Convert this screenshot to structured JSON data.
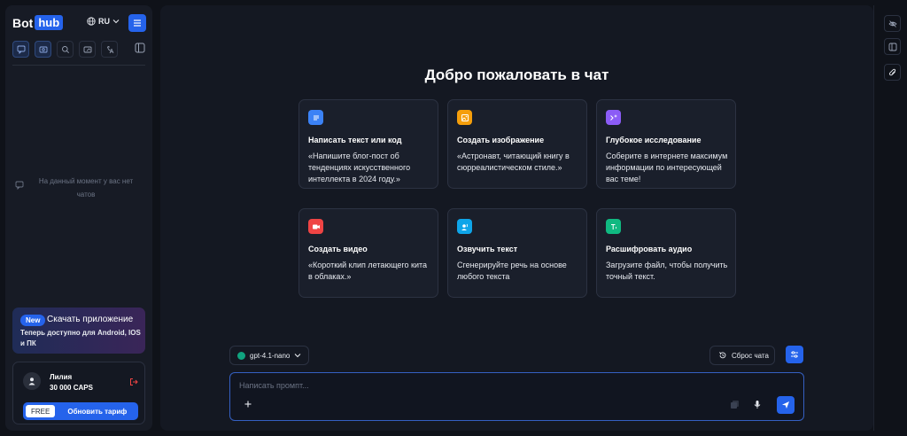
{
  "sidebar": {
    "logo": {
      "part1": "Bot",
      "part2": "hub"
    },
    "language": "RU",
    "tools": [
      "chat-icon",
      "image-icon",
      "search-icon",
      "media-icon",
      "translate-icon"
    ],
    "empty_text": "На данный момент у вас нет чатов",
    "promo": {
      "badge": "New",
      "title": "Скачать приложение",
      "description": "Теперь доступно для Android, IOS и ПК"
    },
    "user": {
      "name": "Лилия",
      "caps": "30 000 CAPS",
      "plan_badge": "FREE",
      "upgrade_label": "Обновить тариф"
    }
  },
  "main": {
    "welcome": "Добро пожаловать в чат",
    "cards": [
      {
        "title": "Написать текст или код",
        "desc": "«Напишите блог-пост об тенденциях искусственного интеллекта в 2024 году.»",
        "icon": "text-icon",
        "color": "#3b82f6"
      },
      {
        "title": "Создать изображение",
        "desc": "«Астронавт, читающий книгу в сюрреалистическом стиле.»",
        "icon": "image-icon",
        "color": "#f59e0b"
      },
      {
        "title": "Глубокое исследование",
        "desc": "Соберите в интернете максимум информации по интересующей вас теме!",
        "icon": "research-icon",
        "color": "#8b5cf6"
      },
      {
        "title": "Создать видео",
        "desc": "«Короткий клип летающего кита в облаках.»",
        "icon": "video-icon",
        "color": "#ef4444"
      },
      {
        "title": "Озвучить текст",
        "desc": "Сгенерируйте речь на основе любого текста",
        "icon": "voice-icon",
        "color": "#0ea5e9"
      },
      {
        "title": "Расшифровать аудио",
        "desc": "Загрузите файл, чтобы получить точный текст.",
        "icon": "transcribe-icon",
        "color": "#10b981"
      }
    ],
    "model": "gpt-4.1-nano",
    "reset_label": "Сброс чата",
    "input_placeholder": "Написать промпт..."
  },
  "colors": {
    "accent": "#2563eb",
    "background": "#0f1219",
    "panel": "#141822"
  }
}
